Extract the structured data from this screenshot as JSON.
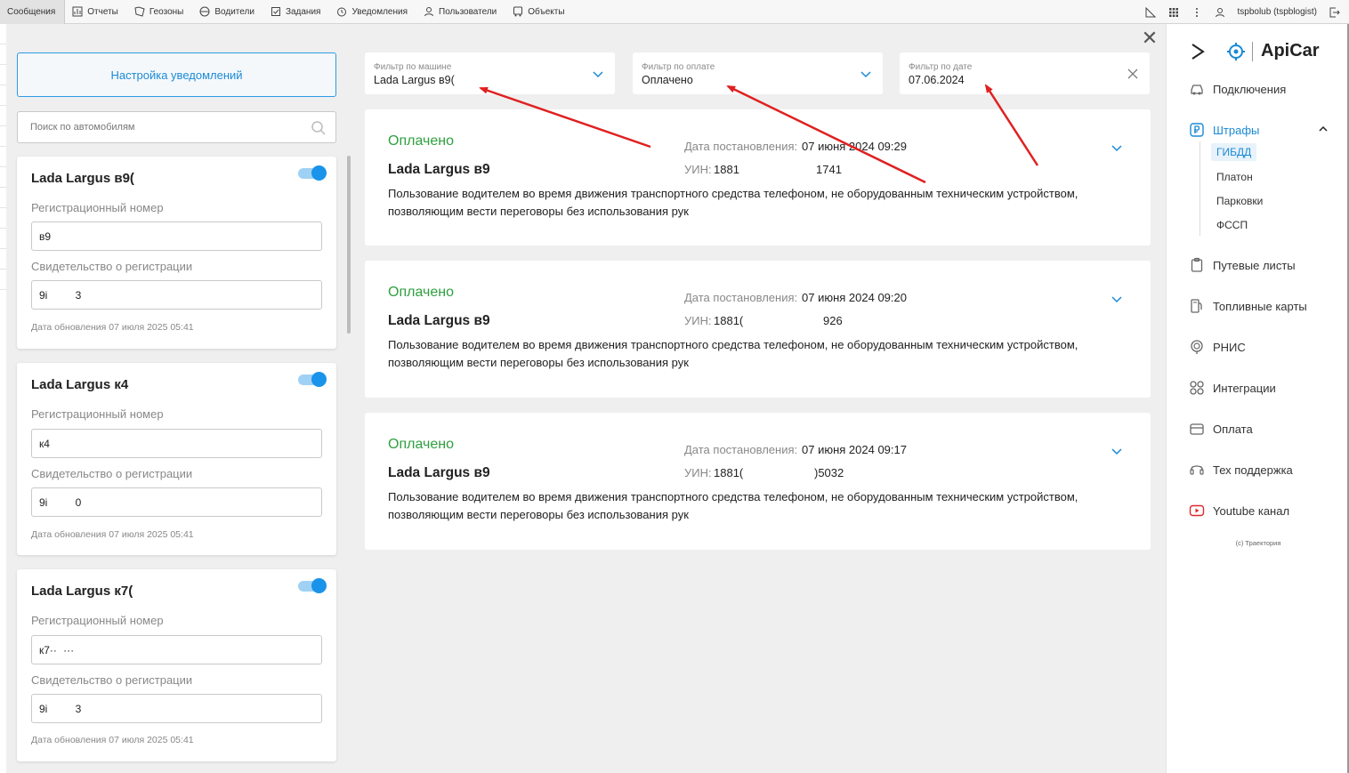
{
  "topbar": {
    "items": [
      {
        "label": "Сообщения"
      },
      {
        "label": "Отчеты"
      },
      {
        "label": "Геозоны"
      },
      {
        "label": "Водители"
      },
      {
        "label": "Задания"
      },
      {
        "label": "Уведомления"
      },
      {
        "label": "Пользователи"
      },
      {
        "label": "Объекты"
      }
    ],
    "user": "tspbolub (tspblogist)"
  },
  "left": {
    "settings_button": "Настройка уведомлений",
    "search_placeholder": "Поиск по автомобилям",
    "cars": [
      {
        "title": "Lada Largus в9(",
        "reg_label": "Регистрационный номер",
        "reg_value": "в9",
        "cert_label": "Свидетельство о регистрации",
        "cert_value": "9і             3",
        "updated": "Дата обновления 07 июля 2025 05:41",
        "enabled": true
      },
      {
        "title": "Lada Largus к4",
        "reg_label": "Регистрационный номер",
        "reg_value": "к4",
        "cert_label": "Свидетельство о регистрации",
        "cert_value": "9і             0",
        "updated": "Дата обновления 07 июля 2025 05:41",
        "enabled": true
      },
      {
        "title": "Lada Largus к7(",
        "reg_label": "Регистрационный номер",
        "reg_value": "к7··   ···",
        "cert_label": "Свидетельство о регистрации",
        "cert_value": "9і             3",
        "updated": "Дата обновления 07 июля 2025 05:41",
        "enabled": true
      }
    ]
  },
  "filters": [
    {
      "label": "Фильтр по машине",
      "value": "Lada Largus в9(",
      "icon": "chevron-down-icon"
    },
    {
      "label": "Фильтр по оплате",
      "value": "Оплачено",
      "icon": "chevron-down-icon"
    },
    {
      "label": "Фильтр по дате",
      "value": "07.06.2024",
      "icon": "clear-icon"
    }
  ],
  "fines": [
    {
      "status": "Оплачено",
      "car": "Lada Largus в9",
      "date_label": "Дата постановления:",
      "date_value": "07 июня 2024 09:29",
      "uin_label": "УИН:",
      "uin_a": "1881",
      "uin_b": "1741",
      "description": "Пользование водителем во время движения транспортного средства телефоном, не оборудованным техническим устройством, позволяющим вести переговоры без использования рук"
    },
    {
      "status": "Оплачено",
      "car": "Lada Largus в9",
      "date_label": "Дата постановления:",
      "date_value": "07 июня 2024 09:20",
      "uin_label": "УИН:",
      "uin_a": "1881(",
      "uin_b": "926",
      "description": "Пользование водителем во время движения транспортного средства телефоном, не оборудованным техническим устройством, позволяющим вести переговоры без использования рук"
    },
    {
      "status": "Оплачено",
      "car": "Lada Largus в9",
      "date_label": "Дата постановления:",
      "date_value": "07 июня 2024 09:17",
      "uin_label": "УИН:",
      "uin_a": "1881(",
      "uin_b": ")5032",
      "description": "Пользование водителем во время движения транспортного средства телефоном, не оборудованным техническим устройством, позволяющим вести переговоры без использования рук"
    }
  ],
  "sidebar": {
    "brand": "ApiCar",
    "nav": [
      {
        "label": "Подключения",
        "icon": "car-icon"
      },
      {
        "label": "Штрафы",
        "icon": "ruble-icon"
      },
      {
        "label": "Путевые листы",
        "icon": "clipboard-icon"
      },
      {
        "label": "Топливные карты",
        "icon": "fuel-icon"
      },
      {
        "label": "РНИС",
        "icon": "location-icon"
      },
      {
        "label": "Интеграции",
        "icon": "grid-icon"
      },
      {
        "label": "Оплата",
        "icon": "wallet-icon"
      },
      {
        "label": "Тех поддержка",
        "icon": "headset-icon"
      },
      {
        "label": "Youtube канал",
        "icon": "youtube-icon"
      }
    ],
    "sub": [
      {
        "label": "ГИБДД"
      },
      {
        "label": "Платон"
      },
      {
        "label": "Парковки"
      },
      {
        "label": "ФССП"
      }
    ],
    "copyright": "(c) Траектория"
  },
  "colors": {
    "accent": "#1a8ad4",
    "paid": "#2e9f3f",
    "annotation_arrow": "#e02020"
  }
}
